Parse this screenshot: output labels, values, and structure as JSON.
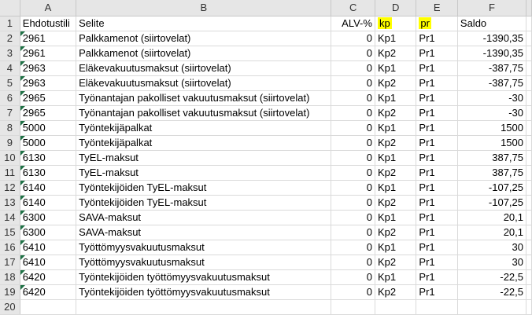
{
  "columns": [
    "A",
    "B",
    "C",
    "D",
    "E",
    "F"
  ],
  "header": {
    "row_num": "1",
    "ehdotustili": "Ehdotustili",
    "selite": "Selite",
    "alv": "ALV-%",
    "kp": "kp",
    "pr": "pr",
    "saldo": "Saldo"
  },
  "rows": [
    {
      "n": "2",
      "a": "2961",
      "b": "Palkkamenot (siirtovelat)",
      "c": "0",
      "d": "Kp1",
      "e": "Pr1",
      "f": "-1390,35"
    },
    {
      "n": "3",
      "a": "2961",
      "b": "Palkkamenot (siirtovelat)",
      "c": "0",
      "d": "Kp2",
      "e": "Pr1",
      "f": "-1390,35"
    },
    {
      "n": "4",
      "a": "2963",
      "b": "Eläkevakuutusmaksut (siirtovelat)",
      "c": "0",
      "d": "Kp1",
      "e": "Pr1",
      "f": "-387,75"
    },
    {
      "n": "5",
      "a": "2963",
      "b": "Eläkevakuutusmaksut (siirtovelat)",
      "c": "0",
      "d": "Kp2",
      "e": "Pr1",
      "f": "-387,75"
    },
    {
      "n": "6",
      "a": "2965",
      "b": "Työnantajan pakolliset vakuutusmaksut (siirtovelat)",
      "c": "0",
      "d": "Kp1",
      "e": "Pr1",
      "f": "-30"
    },
    {
      "n": "7",
      "a": "2965",
      "b": "Työnantajan pakolliset vakuutusmaksut (siirtovelat)",
      "c": "0",
      "d": "Kp2",
      "e": "Pr1",
      "f": "-30"
    },
    {
      "n": "8",
      "a": "5000",
      "b": "Työntekijäpalkat",
      "c": "0",
      "d": "Kp1",
      "e": "Pr1",
      "f": "1500"
    },
    {
      "n": "9",
      "a": "5000",
      "b": "Työntekijäpalkat",
      "c": "0",
      "d": "Kp2",
      "e": "Pr1",
      "f": "1500"
    },
    {
      "n": "10",
      "a": "6130",
      "b": "TyEL-maksut",
      "c": "0",
      "d": "Kp1",
      "e": "Pr1",
      "f": "387,75"
    },
    {
      "n": "11",
      "a": "6130",
      "b": "TyEL-maksut",
      "c": "0",
      "d": "Kp2",
      "e": "Pr1",
      "f": "387,75"
    },
    {
      "n": "12",
      "a": "6140",
      "b": "Työntekijöiden TyEL-maksut",
      "c": "0",
      "d": "Kp1",
      "e": "Pr1",
      "f": "-107,25"
    },
    {
      "n": "13",
      "a": "6140",
      "b": "Työntekijöiden TyEL-maksut",
      "c": "0",
      "d": "Kp2",
      "e": "Pr1",
      "f": "-107,25"
    },
    {
      "n": "14",
      "a": "6300",
      "b": "SAVA-maksut",
      "c": "0",
      "d": "Kp1",
      "e": "Pr1",
      "f": "20,1"
    },
    {
      "n": "15",
      "a": "6300",
      "b": "SAVA-maksut",
      "c": "0",
      "d": "Kp2",
      "e": "Pr1",
      "f": "20,1"
    },
    {
      "n": "16",
      "a": "6410",
      "b": "Työttömyysvakuutusmaksut",
      "c": "0",
      "d": "Kp1",
      "e": "Pr1",
      "f": "30"
    },
    {
      "n": "17",
      "a": "6410",
      "b": "Työttömyysvakuutusmaksut",
      "c": "0",
      "d": "Kp2",
      "e": "Pr1",
      "f": "30"
    },
    {
      "n": "18",
      "a": "6420",
      "b": "Työntekijöiden työttömyysvakuutusmaksut",
      "c": "0",
      "d": "Kp1",
      "e": "Pr1",
      "f": "-22,5"
    },
    {
      "n": "19",
      "a": "6420",
      "b": "Työntekijöiden työttömyysvakuutusmaksut",
      "c": "0",
      "d": "Kp2",
      "e": "Pr1",
      "f": "-22,5"
    }
  ],
  "empty_row": "20",
  "colors": {
    "highlight": "#ffff00",
    "indicator": "#1e7145"
  }
}
